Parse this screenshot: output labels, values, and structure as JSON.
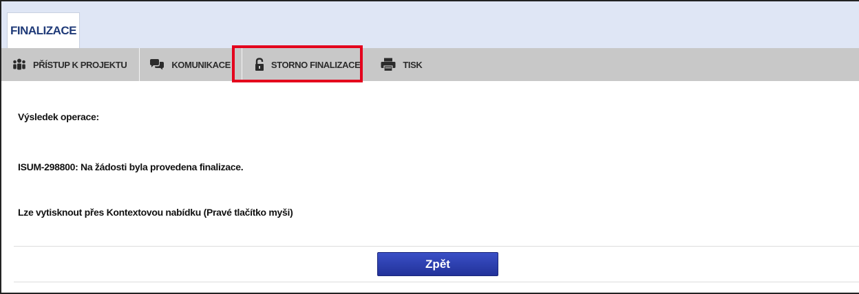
{
  "tabs": [
    {
      "label": "FINALIZACE",
      "active": true
    }
  ],
  "toolbar": {
    "items": [
      {
        "label": "PŘÍSTUP K PROJEKTU",
        "icon": "users-icon"
      },
      {
        "label": "KOMUNIKACE",
        "icon": "chat-icon"
      },
      {
        "label": "STORNO FINALIZACE",
        "icon": "unlock-icon",
        "highlighted": true
      },
      {
        "label": "TISK",
        "icon": "printer-icon"
      }
    ]
  },
  "content": {
    "result_heading": "Výsledek operace:",
    "result_message": "ISUM-298800: Na žádosti byla provedena finalizace.",
    "print_hint": "Lze vytisknout přes Kontextovou nabídku (Pravé tlačítko myši)"
  },
  "actions": {
    "back_label": "Zpět"
  },
  "colors": {
    "tab_bar_bg": "#dfe6f5",
    "toolbar_bg": "#c8c8c8",
    "accent_blue": "#1f3a78",
    "button_blue": "#2c3db0",
    "highlight_red": "#e4001c"
  }
}
